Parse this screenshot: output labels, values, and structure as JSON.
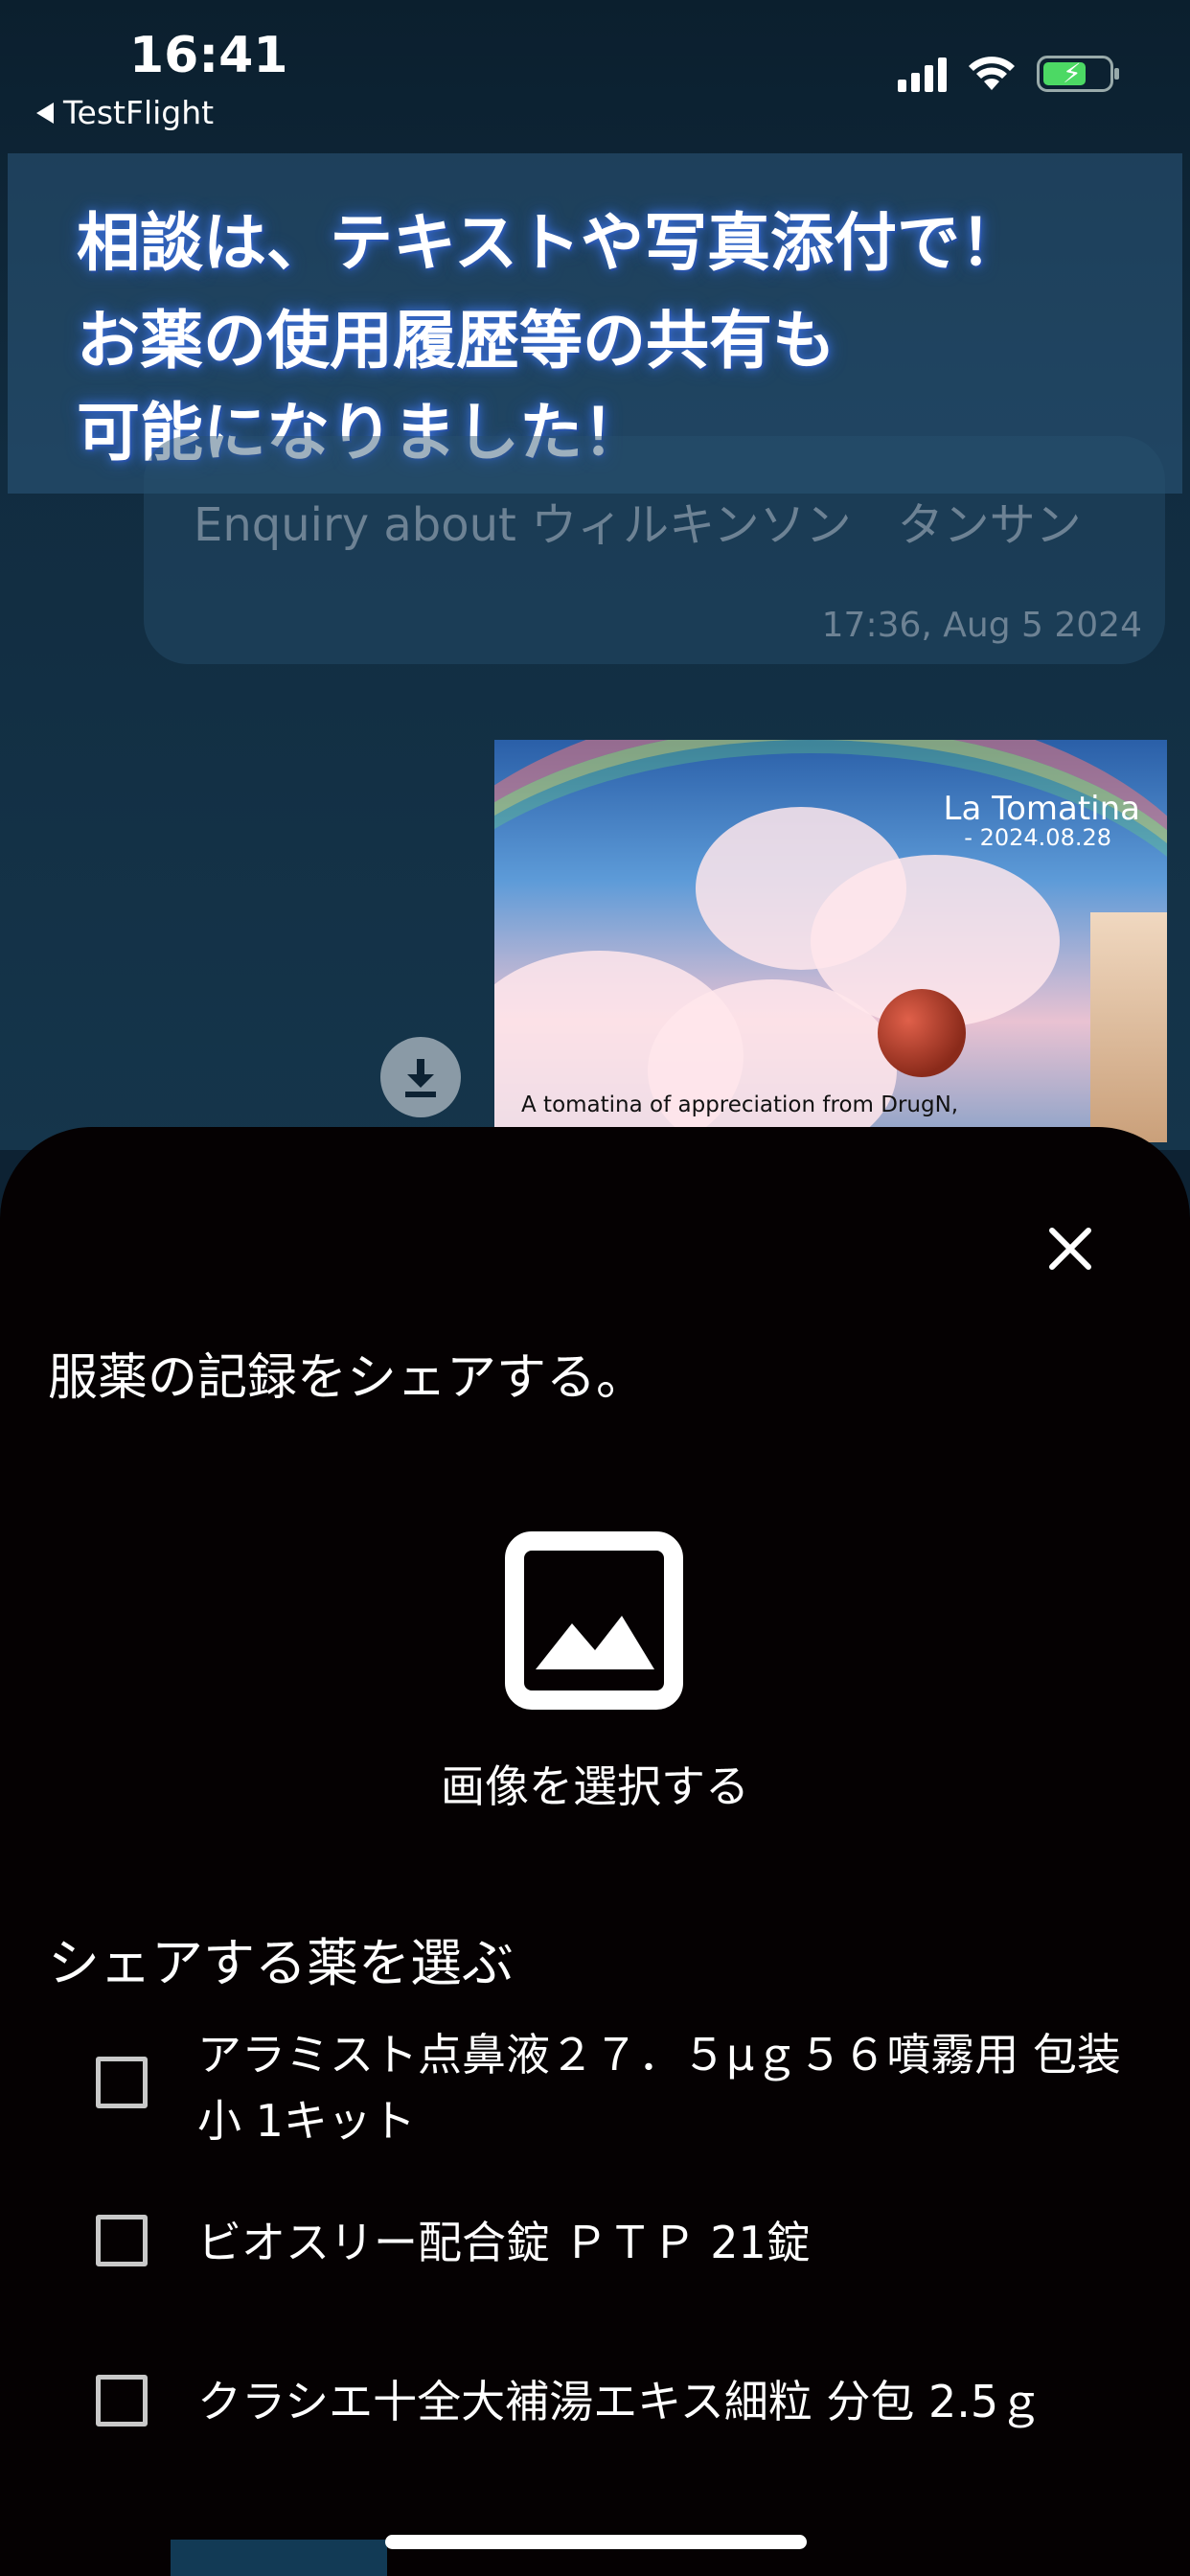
{
  "status_bar": {
    "time": "16:41",
    "back_label": "TestFlight"
  },
  "banner": {
    "lines": [
      "相談は、テキストや写真添付で！",
      "お薬の使用履歴等の共有も",
      "可能になりました！"
    ]
  },
  "chat": {
    "message_text": "Enquiry about ウィルキンソン　タンサン",
    "message_time": "17:36, Aug 5 2024",
    "photo": {
      "title": "La Tomatina",
      "date": "- 2024.08.28",
      "caption": "A tomatina of appreciation from DrugN,"
    }
  },
  "sheet": {
    "title": "服薬の記録をシェアする。",
    "image_picker_label": "画像を選択する",
    "section_title": "シェアする薬を選ぶ",
    "medications": [
      {
        "label": "アラミスト点鼻液２７．５μｇ５６噴霧用 包装小 1キット",
        "checked": false
      },
      {
        "label": "ビオスリー配合錠 ＰＴＰ 21錠",
        "checked": false
      },
      {
        "label": "クラシエ十全大補湯エキス細粒 分包 2.5ｇ",
        "checked": false
      }
    ]
  },
  "colors": {
    "sheet_background": "#050102",
    "banner_text_glow": "#3a6fd0",
    "battery_fill": "#4cd964"
  }
}
